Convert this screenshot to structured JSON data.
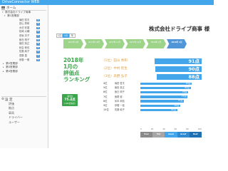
{
  "app": {
    "title": "DriveConnector WEB"
  },
  "sidebar": {
    "home": "ホーム",
    "tree": [
      {
        "label": "株式会社ドライブ商事",
        "indent": 3
      },
      {
        "label": "第1営業部",
        "indent": 6
      }
    ],
    "people": [
      {
        "name": "篠田 哲夫",
        "tag": "B"
      },
      {
        "name": "田山 秀和",
        "tag": "B"
      },
      {
        "name": "水沢 彩香",
        "tag": "B"
      },
      {
        "name": "松崎 大輔",
        "tag": "B"
      },
      {
        "name": "田坂 清子",
        "tag": "B"
      },
      {
        "name": "飯島 明子",
        "tag": "B"
      },
      {
        "name": "飯田 英正",
        "tag": "B"
      },
      {
        "name": "秋吉 和也",
        "tag": "B"
      },
      {
        "name": "佐藤 純子",
        "tag": "B"
      },
      {
        "name": "齋藤 直",
        "tag": "B"
      },
      {
        "name": "伊藤 一義",
        "tag": "B"
      }
    ],
    "groups": [
      "第2営業部",
      "第3営業部",
      "第4営業部"
    ],
    "settings": {
      "title": "設 定",
      "items": [
        "評価",
        "拠点",
        "車両",
        "ドライバー",
        "ユーザー"
      ]
    }
  },
  "main": {
    "period_buttons": [
      "1日",
      "1月",
      "年"
    ],
    "period_active": 1,
    "company": "株式会社ドライブ商事 様",
    "months": [
      "2017年 9月",
      "2017年 10月",
      "2017年 11月",
      "2017年 12月",
      "2018年 1月",
      "2018年 1月"
    ],
    "month_active": 5,
    "ranking_title": [
      "2018年",
      "1月の",
      "評価点",
      "ランキング"
    ],
    "average": {
      "label": "平均",
      "value": "75.4点",
      "note": "(100点満点)"
    },
    "top3": [
      {
        "rank": "1位",
        "name": "田山 秀和",
        "score": "91点",
        "fraction": 0.91
      },
      {
        "rank": "2位",
        "name": "中村 智生",
        "score": "90点",
        "fraction": 0.9
      },
      {
        "rank": "3位",
        "name": "高野 弘子",
        "score": "88点",
        "fraction": 0.88
      }
    ],
    "others": [
      {
        "rank": "4位",
        "name": "篠田 哲夫",
        "score": "84点",
        "fraction": 0.84
      },
      {
        "rank": "5位",
        "name": "飯田 英正",
        "score": "82点",
        "fraction": 0.82
      },
      {
        "rank": "6位",
        "name": "飯島 明子",
        "score": "78点",
        "fraction": 0.78
      },
      {
        "rank": "7位",
        "name": "飯尾 健",
        "score": "77点",
        "fraction": 0.77
      },
      {
        "rank": "8位",
        "name": "米本 和信",
        "score": "71点",
        "fraction": 0.71
      },
      {
        "rank": "9位",
        "name": "伊藤 一義",
        "score": "65点",
        "fraction": 0.65
      },
      {
        "rank": "10位",
        "name": "佐藤 純子",
        "score": "60点",
        "fraction": 0.6
      }
    ],
    "axis_ticks": [
      "0",
      "20",
      "40",
      "60",
      "80",
      "100"
    ],
    "legend": [
      {
        "label": "Poor",
        "color": "#8a8a8a"
      },
      {
        "label": "Fair",
        "color": "#a6a6a6"
      },
      {
        "label": "Good",
        "color": "#43a6ea"
      },
      {
        "label": "Great",
        "color": "#2f8ad1"
      },
      {
        "label": "Best",
        "color": "#1f6fb2"
      }
    ],
    "colors": {
      "accent": "#43a6ea",
      "green": "#3aa54a",
      "top_rank": "#e2a13a"
    }
  }
}
